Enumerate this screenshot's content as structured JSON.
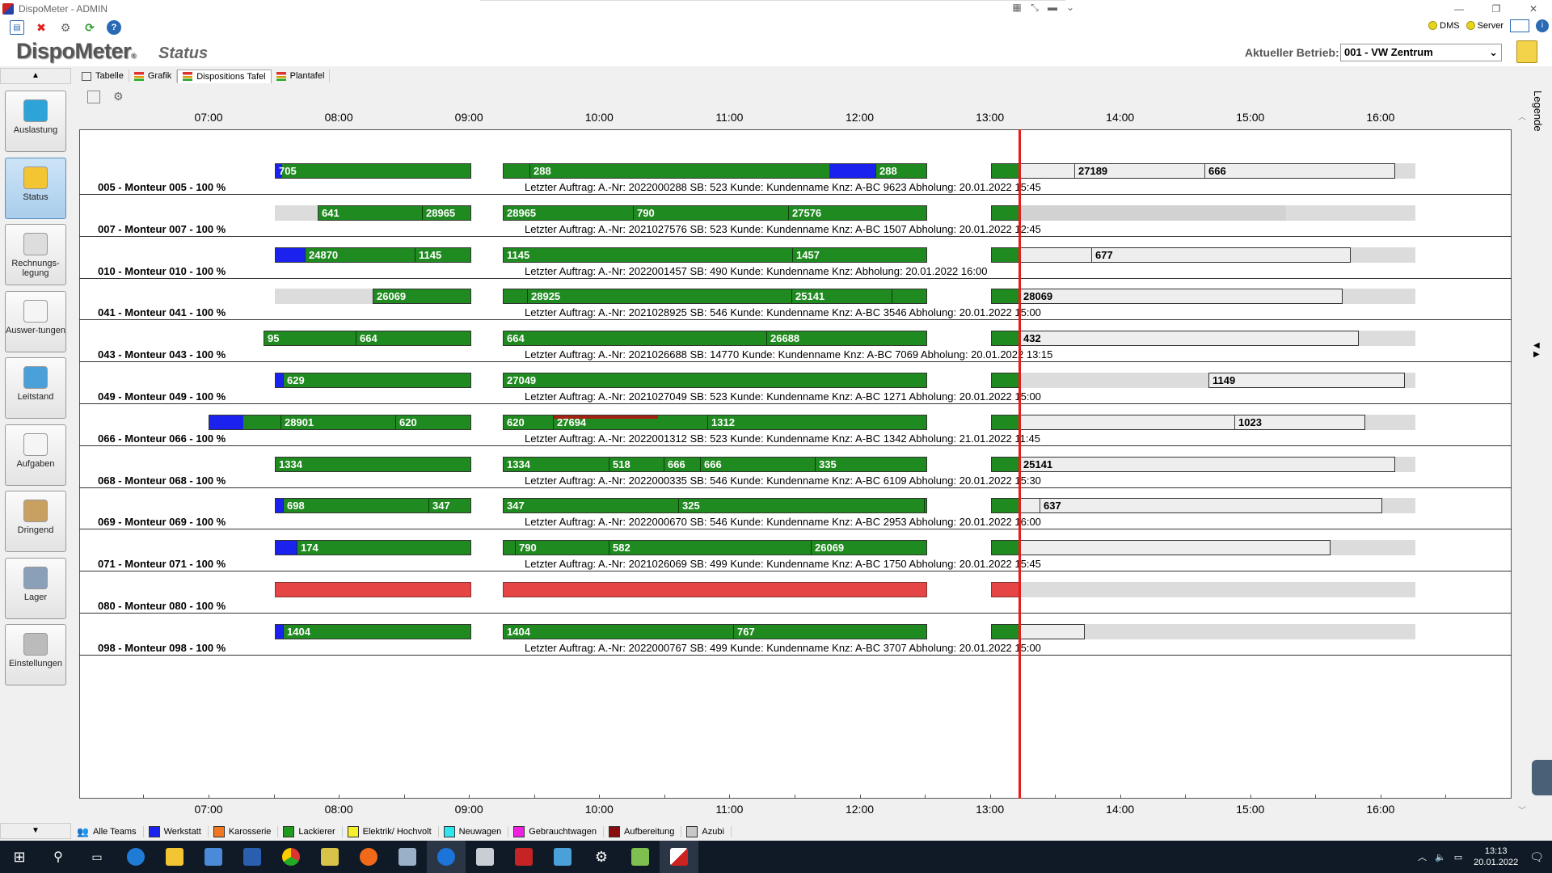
{
  "window": {
    "title": "DispoMeter - ADMIN"
  },
  "toolbar": {
    "dms_label": "DMS",
    "server_label": "Server"
  },
  "header": {
    "logo": "DispoMeter",
    "page_title": "Status",
    "betrieb_label": "Aktueller Betrieb:",
    "betrieb_value": "001 - VW Zentrum"
  },
  "sidebar": {
    "items": [
      {
        "label": "Auslastung",
        "icon": "cubes-icon"
      },
      {
        "label": "Status",
        "icon": "clipboard-icon"
      },
      {
        "label": "Rechnungs-legung",
        "icon": "calculator-icon"
      },
      {
        "label": "Auswer-tungen",
        "icon": "chart-icon"
      },
      {
        "label": "Leitstand",
        "icon": "monitor-icon"
      },
      {
        "label": "Aufgaben",
        "icon": "notepad-icon"
      },
      {
        "label": "Dringend",
        "icon": "alarm-icon"
      },
      {
        "label": "Lager",
        "icon": "basket-icon"
      },
      {
        "label": "Einstellungen",
        "icon": "gear-icon"
      }
    ]
  },
  "tabs": [
    "Tabelle",
    "Grafik",
    "Dispositions Tafel",
    "Plantafel"
  ],
  "right_panel": {
    "legend_tab": "Legende"
  },
  "hours": [
    "07:00",
    "08:00",
    "09:00",
    "10:00",
    "11:00",
    "12:00",
    "13:00",
    "14:00",
    "15:00",
    "16:00"
  ],
  "rows": [
    {
      "label": "005 - Monteur 005 - 100 %",
      "info": "Letzter Auftrag: A.-Nr: 2022000288 SB: 523 Kunde: Kundenname Knz: A-BC 9623 Abholung: 20.01.2022 15:45",
      "seg_a": [
        "705"
      ],
      "seg_b": [
        "288",
        "288"
      ],
      "seg_c": [
        "27189",
        "666"
      ]
    },
    {
      "label": "007 - Monteur 007 - 100 %",
      "info": "Letzter Auftrag: A.-Nr: 2021027576 SB: 523 Kunde: Kundenname Knz: A-BC 1507 Abholung: 20.01.2022 12:45",
      "seg_a": [
        "641",
        "28965"
      ],
      "seg_b": [
        "28965",
        "790",
        "27576"
      ],
      "seg_c": []
    },
    {
      "label": "010 - Monteur 010 - 100 %",
      "info": "Letzter Auftrag: A.-Nr: 2022001457 SB: 490 Kunde: Kundenname Knz:  Abholung: 20.01.2022 16:00",
      "seg_a": [
        "24870",
        "1145"
      ],
      "seg_b": [
        "1145",
        "1457"
      ],
      "seg_c": [
        "677"
      ]
    },
    {
      "label": "041 - Monteur 041 - 100 %",
      "info": "Letzter Auftrag: A.-Nr: 2021028925 SB: 546 Kunde: Kundenname Knz: A-BC 3546 Abholung: 20.01.2022 15:00",
      "seg_a": [
        "26069"
      ],
      "seg_b": [
        "28925",
        "25141"
      ],
      "seg_c": [
        "28069"
      ]
    },
    {
      "label": "043 - Monteur 043 - 100 %",
      "info": "Letzter Auftrag: A.-Nr: 2021026688 SB: 14770 Kunde: Kundenname Knz: A-BC 7069 Abholung: 20.01.2022 13:15",
      "seg_a": [
        "95",
        "664"
      ],
      "seg_b": [
        "664",
        "26688"
      ],
      "seg_c": [
        "432"
      ]
    },
    {
      "label": "049 - Monteur 049 - 100 %",
      "info": "Letzter Auftrag: A.-Nr: 2021027049 SB: 523 Kunde: Kundenname Knz: A-BC 1271 Abholung: 20.01.2022 15:00",
      "seg_a": [
        "629"
      ],
      "seg_b": [
        "27049"
      ],
      "seg_c": [
        "1149"
      ]
    },
    {
      "label": "066 - Monteur 066 - 100 %",
      "info": "Letzter Auftrag: A.-Nr: 2022001312 SB: 523 Kunde: Kundenname Knz: A-BC 1342 Abholung: 21.01.2022 11:45",
      "seg_a": [
        "28901",
        "620"
      ],
      "seg_b": [
        "620",
        "27694",
        "1312"
      ],
      "seg_c": [
        "1023"
      ]
    },
    {
      "label": "068 - Monteur 068 - 100 %",
      "info": "Letzter Auftrag: A.-Nr: 2022000335 SB: 546 Kunde: Kundenname Knz: A-BC 6109 Abholung: 20.01.2022 15:30",
      "seg_a": [
        "1334"
      ],
      "seg_b": [
        "1334",
        "518",
        "666",
        "666",
        "335"
      ],
      "seg_c": [
        "25141"
      ]
    },
    {
      "label": "069 - Monteur 069 - 100 %",
      "info": "Letzter Auftrag: A.-Nr: 2022000670 SB: 546 Kunde: Kundenname Knz: A-BC 2953 Abholung: 20.01.2022 16:00",
      "seg_a": [
        "698",
        "347"
      ],
      "seg_b": [
        "347",
        "325"
      ],
      "seg_c": [
        "637"
      ]
    },
    {
      "label": "071 - Monteur 071 - 100 %",
      "info": "Letzter Auftrag: A.-Nr: 2021026069 SB: 499 Kunde: Kundenname Knz: A-BC 1750 Abholung: 20.01.2022 15:45",
      "seg_a": [
        "174"
      ],
      "seg_b": [
        "790",
        "582",
        "26069"
      ],
      "seg_c": []
    },
    {
      "label": "080 - Monteur 080 - 100 %",
      "info": "",
      "seg_a": [],
      "seg_b": [],
      "seg_c": []
    },
    {
      "label": "098 - Monteur 098 - 100 %",
      "info": "Letzter Auftrag: A.-Nr: 2022000767 SB: 499 Kunde: Kundenname Knz: A-BC 3707 Abholung: 20.01.2022 15:00",
      "seg_a": [
        "1404"
      ],
      "seg_b": [
        "1404",
        "767"
      ],
      "seg_c": []
    }
  ],
  "legend": {
    "all_teams": "Alle Teams",
    "items": [
      {
        "label": "Werkstatt",
        "color": "#1b22ee"
      },
      {
        "label": "Karosserie",
        "color": "#f07820"
      },
      {
        "label": "Lackierer",
        "color": "#1f9a1f"
      },
      {
        "label": "Elektrik/ Hochvolt",
        "color": "#f5f02a"
      },
      {
        "label": "Neuwagen",
        "color": "#2ee6ee"
      },
      {
        "label": "Gebrauchtwagen",
        "color": "#f020e0"
      },
      {
        "label": "Aufbereitung",
        "color": "#8a0d0d"
      },
      {
        "label": "Azubi",
        "color": "#c8c8c8"
      }
    ]
  },
  "taskbar": {
    "time": "13:13",
    "date": "20.01.2022"
  },
  "colors": {
    "bar_green": "#1f8a1f",
    "now_line": "#e51d1d",
    "lane_grey": "#dcdcdc"
  }
}
